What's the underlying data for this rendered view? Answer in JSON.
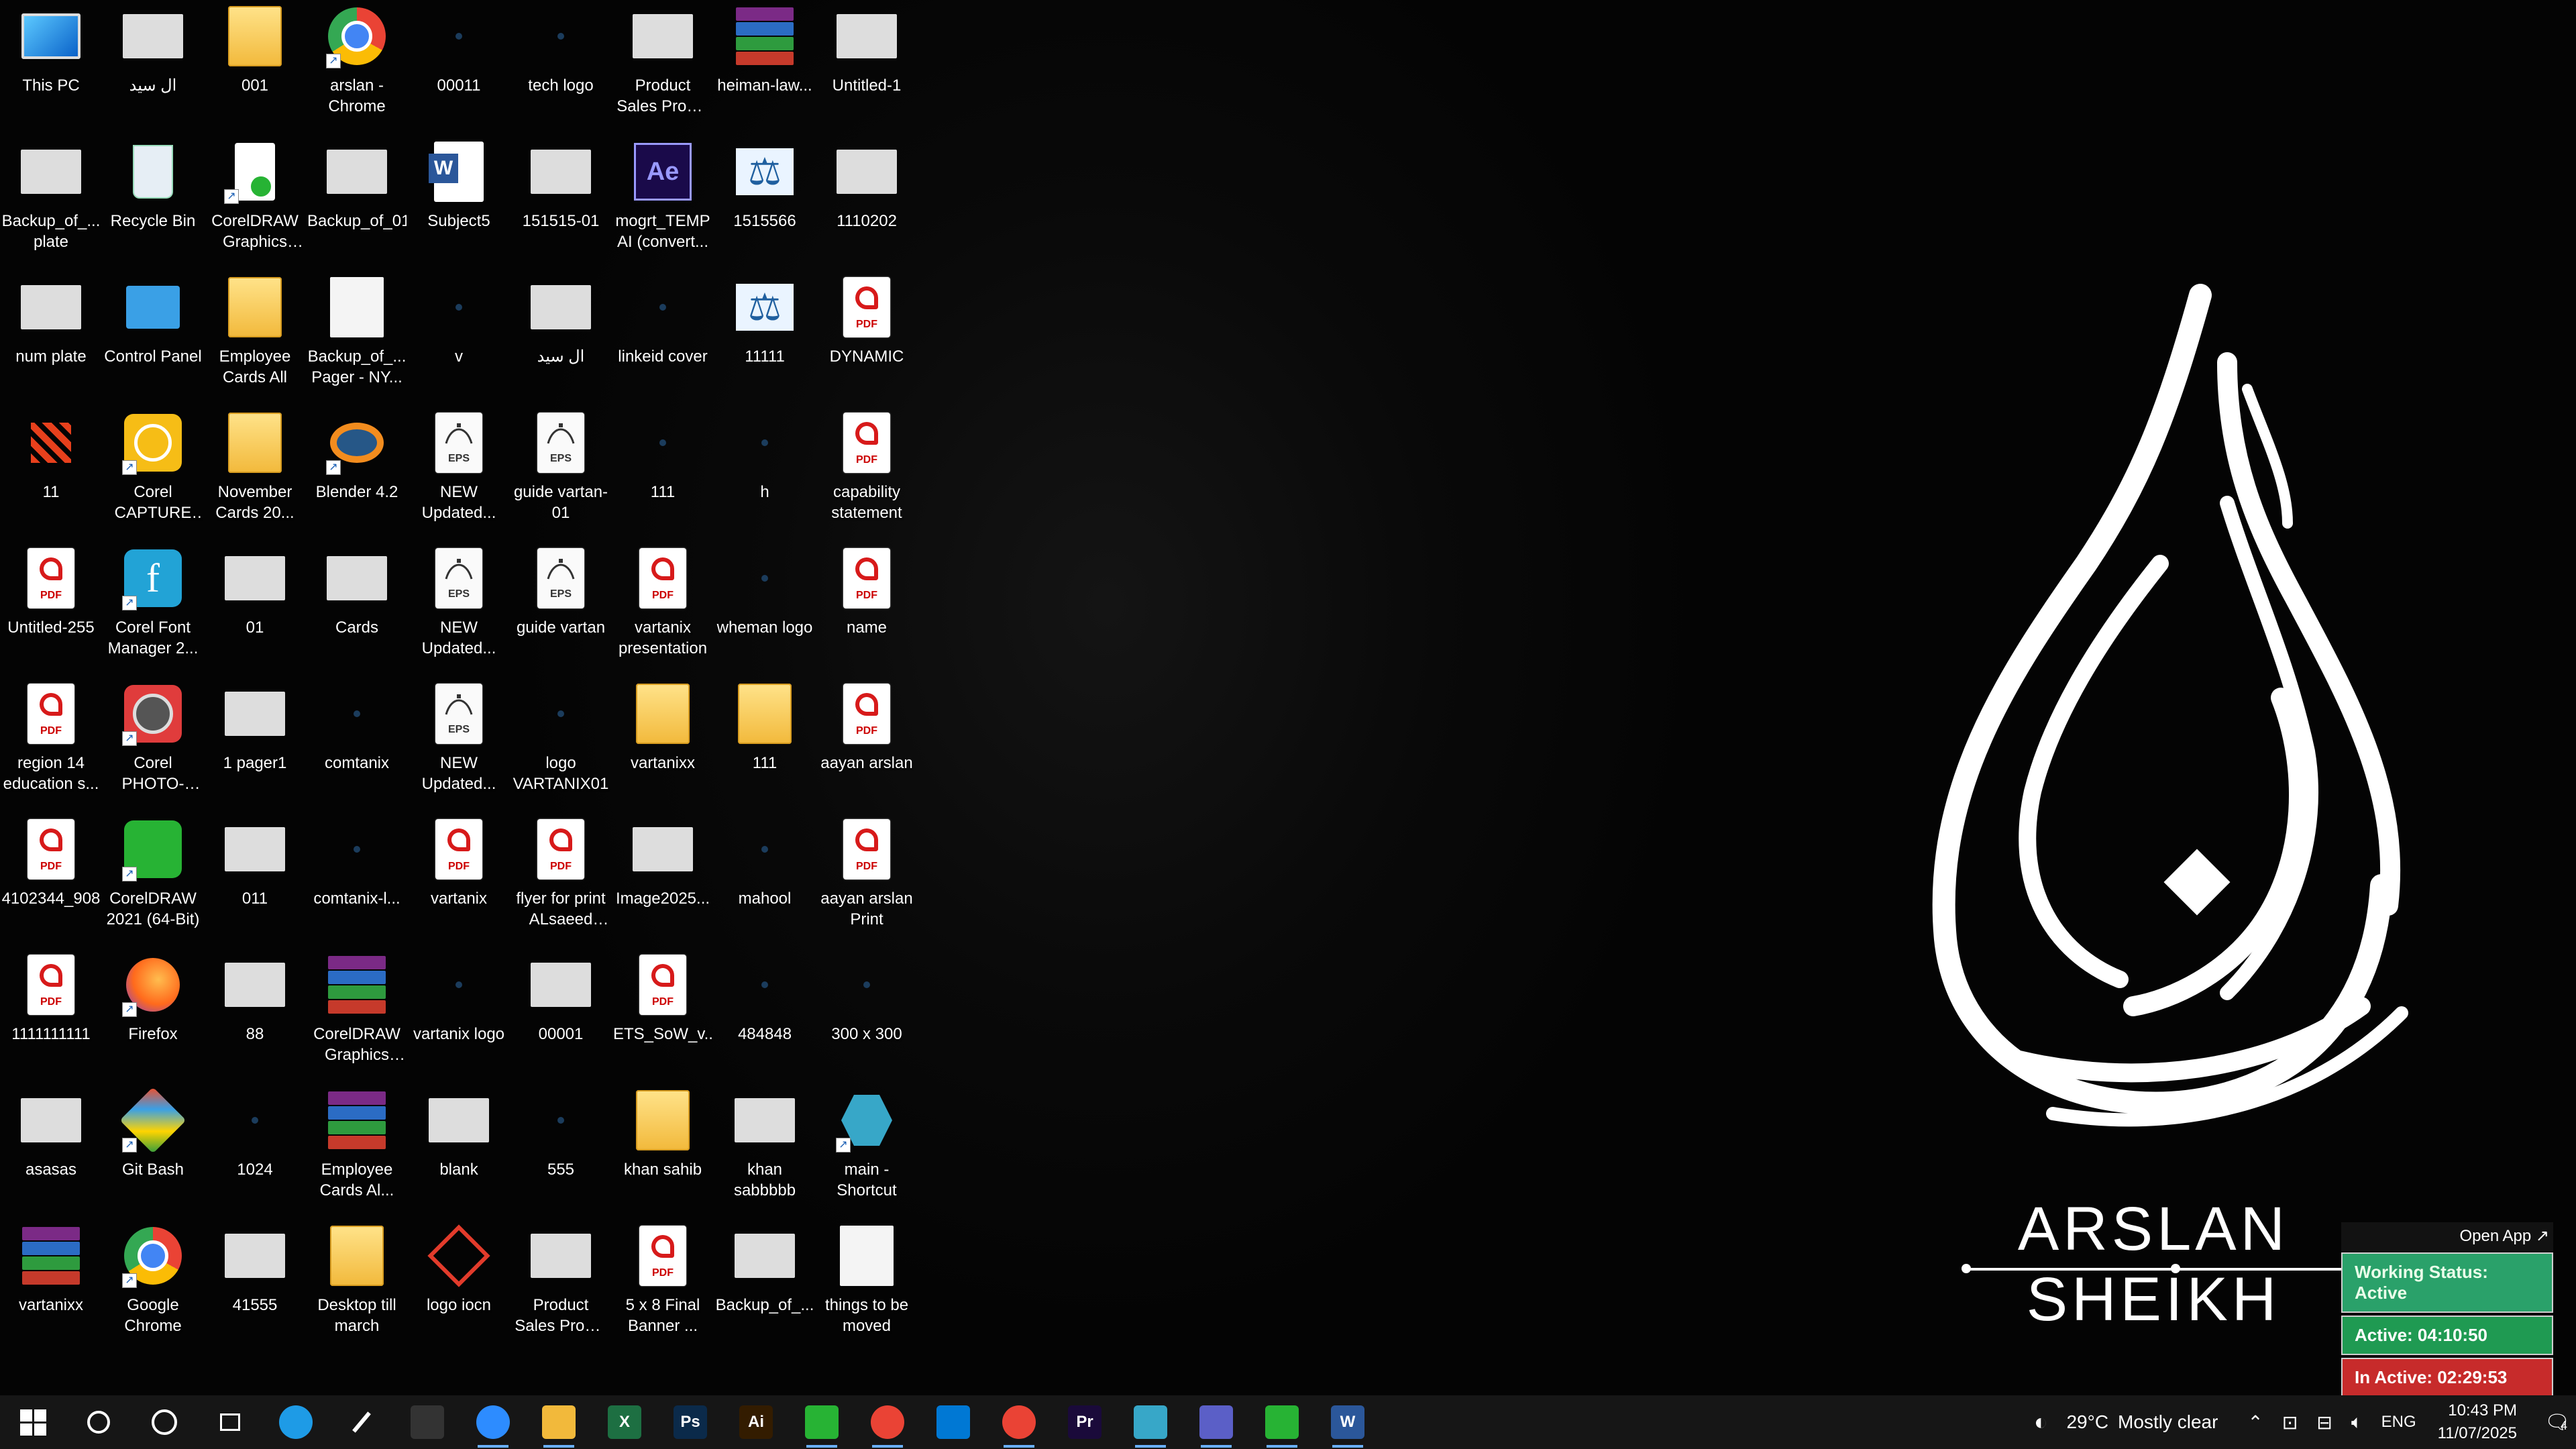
{
  "desktop": {
    "columns": [
      [
        {
          "label": "This PC",
          "icon": "pc-icon"
        },
        {
          "label": "Backup_of_... plate",
          "icon": "image-thumb-icon"
        },
        {
          "label": "num plate",
          "icon": "image-thumb-icon"
        },
        {
          "label": "11",
          "icon": "red-dots-icon"
        },
        {
          "label": "Untitled-255",
          "icon": "pdf-file-icon"
        },
        {
          "label": "region 14 education s...",
          "icon": "pdf-file-icon"
        },
        {
          "label": "4102344_908",
          "icon": "pdf-file-icon"
        },
        {
          "label": "1111111111",
          "icon": "pdf-file-icon"
        },
        {
          "label": "asasas",
          "icon": "image-thumb-icon"
        },
        {
          "label": "vartanixx",
          "icon": "winrar-archive-icon"
        }
      ],
      [
        {
          "label": "ال سید",
          "icon": "image-thumb-icon"
        },
        {
          "label": "Recycle Bin",
          "icon": "recycle-bin-icon"
        },
        {
          "label": "Control Panel",
          "icon": "control-panel-icon"
        },
        {
          "label": "Corel CAPTURE 2...",
          "icon": "corel-capture-icon"
        },
        {
          "label": "Corel Font Manager 2...",
          "icon": "corel-font-manager-icon"
        },
        {
          "label": "Corel PHOTO-PAI...",
          "icon": "corel-photo-paint-icon"
        },
        {
          "label": "CorelDRAW 2021 (64-Bit)",
          "icon": "coreldraw-icon"
        },
        {
          "label": "Firefox",
          "icon": "firefox-icon"
        },
        {
          "label": "Git Bash",
          "icon": "git-bash-icon"
        },
        {
          "label": "Google Chrome",
          "icon": "chrome-icon"
        }
      ],
      [
        {
          "label": "001",
          "icon": "folder-icon"
        },
        {
          "label": "CorelDRAW Graphics Su...",
          "icon": "coreldraw-suite-icon"
        },
        {
          "label": "Employee Cards All",
          "icon": "folder-icon"
        },
        {
          "label": "November Cards 20...",
          "icon": "folder-icon"
        },
        {
          "label": "01",
          "icon": "image-thumb-icon"
        },
        {
          "label": "1 pager1",
          "icon": "image-thumb-icon"
        },
        {
          "label": "011",
          "icon": "image-thumb-icon"
        },
        {
          "label": "88",
          "icon": "image-thumb-icon"
        },
        {
          "label": "1024",
          "icon": "dark-image-icon"
        },
        {
          "label": "41555",
          "icon": "image-thumb-icon"
        }
      ],
      [
        {
          "label": "arslan - Chrome",
          "icon": "chrome-profile-icon"
        },
        {
          "label": "Backup_of_01",
          "icon": "image-thumb-icon"
        },
        {
          "label": "Backup_of_... Pager - NY...",
          "icon": "document-icon"
        },
        {
          "label": "Blender 4.2",
          "icon": "blender-icon"
        },
        {
          "label": "Cards",
          "icon": "image-thumb-icon"
        },
        {
          "label": "comtanix",
          "icon": "dark-image-icon"
        },
        {
          "label": "comtanix-l...",
          "icon": "dark-image-icon"
        },
        {
          "label": "CorelDRAW Graphics Su...",
          "icon": "winrar-archive-icon"
        },
        {
          "label": "Employee Cards Al...",
          "icon": "winrar-archive-icon"
        },
        {
          "label": "Desktop till march",
          "icon": "folder-icon"
        }
      ],
      [
        {
          "label": "00011",
          "icon": "dark-image-icon"
        },
        {
          "label": "Subject5",
          "icon": "word-doc-icon"
        },
        {
          "label": "v",
          "icon": "dark-image-icon"
        },
        {
          "label": "NEW Updated...",
          "icon": "eps-file-icon"
        },
        {
          "label": "NEW Updated...",
          "icon": "eps-file-icon"
        },
        {
          "label": "NEW Updated...",
          "icon": "eps-file-icon"
        },
        {
          "label": "vartanix",
          "icon": "pdf-file-icon"
        },
        {
          "label": "vartanix logo",
          "icon": "dark-image-icon"
        },
        {
          "label": "blank",
          "icon": "image-thumb-icon"
        },
        {
          "label": "logo iocn",
          "icon": "red-logo-icon"
        }
      ],
      [
        {
          "label": "tech logo",
          "icon": "dark-image-icon"
        },
        {
          "label": "151515-01",
          "icon": "image-thumb-icon"
        },
        {
          "label": "ال سید",
          "icon": "image-thumb-icon"
        },
        {
          "label": "guide vartan-01",
          "icon": "eps-file-icon"
        },
        {
          "label": "guide vartan",
          "icon": "eps-file-icon"
        },
        {
          "label": "logo VARTANIX01",
          "icon": "dark-image-icon"
        },
        {
          "label": "flyer for print ALsaeed po...",
          "icon": "pdf-file-icon"
        },
        {
          "label": "00001",
          "icon": "image-thumb-icon"
        },
        {
          "label": "555",
          "icon": "dark-image-icon"
        },
        {
          "label": "Product Sales Promo Pack...",
          "icon": "image-thumb-icon"
        }
      ],
      [
        {
          "label": "Product Sales Promo Pack...",
          "icon": "image-thumb-icon"
        },
        {
          "label": "mogrt_TEMP AI (convert...",
          "icon": "after-effects-icon"
        },
        {
          "label": "linkeid cover",
          "icon": "dark-image-icon"
        },
        {
          "label": "111",
          "icon": "dark-image-icon"
        },
        {
          "label": "vartanix presentation",
          "icon": "pdf-file-icon"
        },
        {
          "label": "vartanixx",
          "icon": "folder-icon"
        },
        {
          "label": "Image2025...",
          "icon": "image-thumb-icon"
        },
        {
          "label": "ETS_SoW_v...",
          "icon": "pdf-file-icon"
        },
        {
          "label": "khan sahib",
          "icon": "folder-icon"
        },
        {
          "label": "5 x 8 Final Banner ...",
          "icon": "pdf-file-icon"
        }
      ],
      [
        {
          "label": "heiman-law...",
          "icon": "winrar-archive-icon"
        },
        {
          "label": "1515566",
          "icon": "scales-icon"
        },
        {
          "label": "11111",
          "icon": "scales-icon"
        },
        {
          "label": "h",
          "icon": "dark-image-icon"
        },
        {
          "label": "wheman logo",
          "icon": "dark-image-icon"
        },
        {
          "label": "111",
          "icon": "folder-icon"
        },
        {
          "label": "mahool",
          "icon": "dark-image-icon"
        },
        {
          "label": "484848",
          "icon": "dark-image-icon"
        },
        {
          "label": "khan sabbbbb",
          "icon": "image-thumb-icon"
        },
        {
          "label": "Backup_of_...",
          "icon": "image-thumb-icon"
        }
      ],
      [
        {
          "label": "Untitled-1",
          "icon": "image-thumb-icon"
        },
        {
          "label": "1110202",
          "icon": "image-thumb-icon"
        },
        {
          "label": "DYNAMIC",
          "icon": "pdf-file-icon"
        },
        {
          "label": "capability statement",
          "icon": "pdf-file-icon"
        },
        {
          "label": "name",
          "icon": "pdf-file-icon"
        },
        {
          "label": "aayan arslan",
          "icon": "pdf-file-icon"
        },
        {
          "label": "aayan arslan Print",
          "icon": "pdf-file-icon"
        },
        {
          "label": "300 x 300",
          "icon": "dark-image-icon"
        },
        {
          "label": "main - Shortcut",
          "icon": "main-shortcut-icon"
        },
        {
          "label": "things to be moved",
          "icon": "document-icon"
        }
      ]
    ]
  },
  "wallpaper": {
    "name_text": "ARSLAN SHEIKH"
  },
  "work_widget": {
    "open_app": "Open App ↗",
    "status": "Working Status: Active",
    "active": "Active: 04:10:50",
    "inactive": "In Active: 02:29:53"
  },
  "taskbar": {
    "apps": [
      {
        "name": "start-button",
        "icon": "windows-icon",
        "color": "#ffffff"
      },
      {
        "name": "search-button",
        "icon": "search-icon",
        "color": "#ffffff"
      },
      {
        "name": "cortana-button",
        "icon": "cortana-circle-icon",
        "color": "#ffffff"
      },
      {
        "name": "task-view-button",
        "icon": "task-view-icon",
        "color": "#ffffff"
      },
      {
        "name": "edge-taskbar",
        "icon": "edge-icon",
        "color": "#1e9be6"
      },
      {
        "name": "pen-taskbar",
        "icon": "pen-icon",
        "color": "#ffffff"
      },
      {
        "name": "terminal-taskbar",
        "icon": "terminal-icon",
        "color": "#333333"
      },
      {
        "name": "zoom-taskbar",
        "icon": "zoom-icon",
        "color": "#2d8cff"
      },
      {
        "name": "file-explorer-taskbar",
        "icon": "folder-icon",
        "color": "#f2b93b"
      },
      {
        "name": "excel-taskbar",
        "icon": "excel-icon",
        "color": "#1d6f42"
      },
      {
        "name": "photoshop-taskbar",
        "icon": "photoshop-icon",
        "color": "#0b2a4a"
      },
      {
        "name": "illustrator-taskbar",
        "icon": "illustrator-icon",
        "color": "#331c00"
      },
      {
        "name": "coreldraw-taskbar",
        "icon": "coreldraw-icon",
        "color": "#27b334"
      },
      {
        "name": "chrome-taskbar",
        "icon": "chrome-icon",
        "color": "#ea4335"
      },
      {
        "name": "vscode-taskbar",
        "icon": "vscode-icon",
        "color": "#0078d4"
      },
      {
        "name": "chrome-profile-taskbar",
        "icon": "chrome-profile-icon",
        "color": "#ea4335"
      },
      {
        "name": "premiere-taskbar",
        "icon": "premiere-icon",
        "color": "#1a0a3a"
      },
      {
        "name": "app-taskbar",
        "icon": "hexagon-app-icon",
        "color": "#37a7c8"
      },
      {
        "name": "teams-taskbar",
        "icon": "teams-icon",
        "color": "#5b5fc7"
      },
      {
        "name": "coreldraw2-taskbar",
        "icon": "coreldraw-icon",
        "color": "#27b334"
      },
      {
        "name": "word-taskbar",
        "icon": "word-icon",
        "color": "#2b579a"
      }
    ],
    "app_glyphs": {
      "photoshop-icon": "Ps",
      "illustrator-icon": "Ai",
      "premiere-icon": "Pr",
      "excel-icon": "X",
      "word-icon": "W"
    },
    "weather": {
      "temp": "29°C",
      "condition": "Mostly clear"
    },
    "language": "ENG",
    "time": "10:43 PM",
    "date": "11/07/2025",
    "notification_count": "4"
  }
}
